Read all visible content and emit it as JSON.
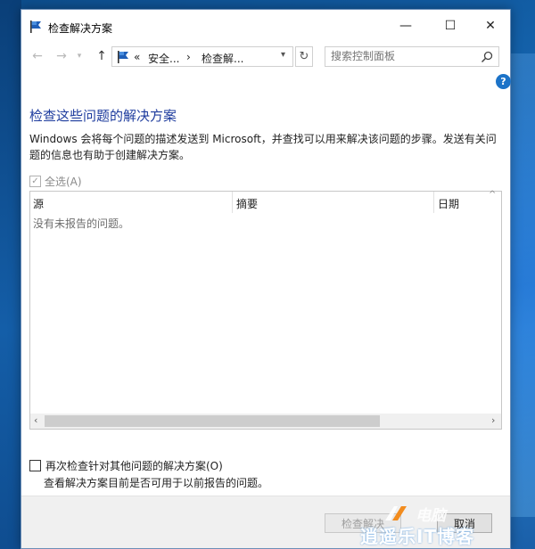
{
  "window": {
    "title": "检查解决方案",
    "controls": {
      "minimize": "—",
      "maximize": "☐",
      "close": "✕"
    }
  },
  "address_bar": {
    "segments": [
      "«",
      "安全...",
      "›",
      "检查解..."
    ],
    "search_placeholder": "搜索控制面板"
  },
  "help_label": "?",
  "content": {
    "heading": "检查这些问题的解决方案",
    "description": "Windows 会将每个问题的描述发送到 Microsoft，并查找可以用来解决该问题的步骤。发送有关问题的信息也有助于创建解决方案。",
    "select_all": "全选(A)",
    "table": {
      "columns": [
        "源",
        "摘要",
        "日期"
      ],
      "empty_message": "没有未报告的问题。"
    },
    "recheck_label": "再次检查针对其他问题的解决方案(O)",
    "recheck_description": "查看解决方案目前是否可用于以前报告的问题。"
  },
  "footer": {
    "check_button": "检查解决",
    "cancel_button": "取消"
  },
  "watermark": {
    "line1": "电脑",
    "line2": "逍遥乐IT博客"
  },
  "colors": {
    "heading": "#1e3c9e",
    "help_icon": "#1c73c8",
    "desktop": "#1565b0"
  }
}
